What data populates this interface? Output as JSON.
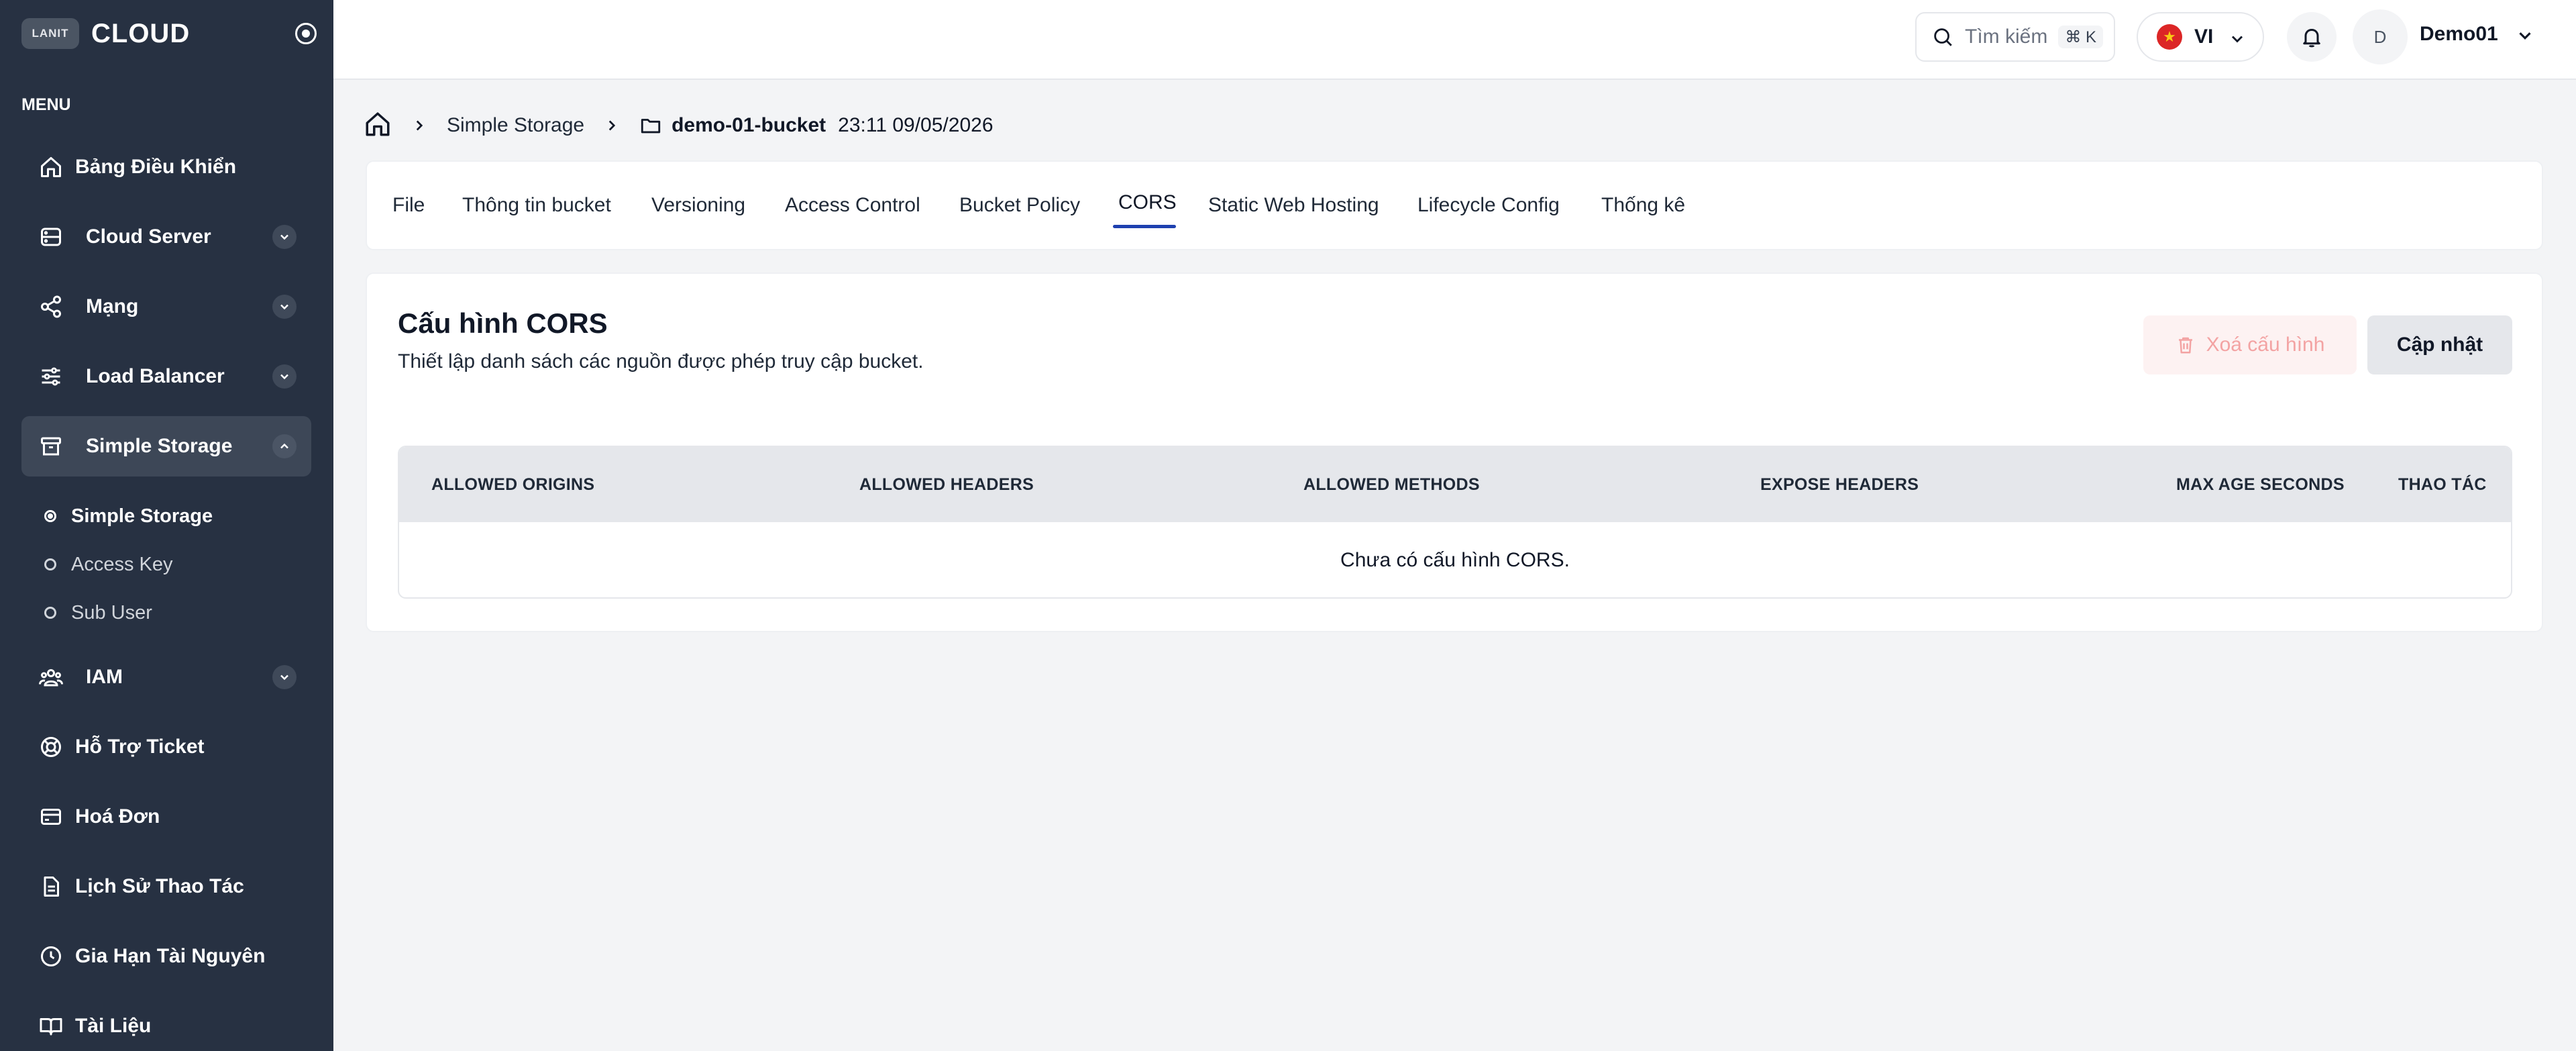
{
  "sidebar": {
    "logo_badge": "LANIT",
    "logo_text": "CLOUD",
    "menu_label": "MENU",
    "items": [
      {
        "label": "Bảng Điều Khiển"
      },
      {
        "label": "Cloud Server"
      },
      {
        "label": "Mạng"
      },
      {
        "label": "Load Balancer"
      },
      {
        "label": "Simple Storage"
      },
      {
        "label": "IAM"
      },
      {
        "label": "Hỗ Trợ Ticket"
      },
      {
        "label": "Hoá Đơn"
      },
      {
        "label": "Lịch Sử Thao Tác"
      },
      {
        "label": "Gia Hạn Tài Nguyên"
      },
      {
        "label": "Tài Liệu"
      }
    ],
    "sub_items": [
      {
        "label": "Simple Storage",
        "active": true
      },
      {
        "label": "Access Key",
        "active": false
      },
      {
        "label": "Sub User",
        "active": false
      }
    ]
  },
  "header": {
    "search_placeholder": "Tìm kiếm",
    "search_shortcut": "⌘ K",
    "language": "VI",
    "avatar_initial": "D",
    "user_name": "Demo01"
  },
  "breadcrumb": {
    "section": "Simple Storage",
    "bucket": "demo-01-bucket",
    "timestamp": "23:11 09/05/2026"
  },
  "tabs": [
    {
      "label": "File"
    },
    {
      "label": "Thông tin bucket"
    },
    {
      "label": "Versioning"
    },
    {
      "label": "Access Control"
    },
    {
      "label": "Bucket Policy"
    },
    {
      "label": "CORS",
      "active": true
    },
    {
      "label": "Static Web Hosting"
    },
    {
      "label": "Lifecycle Config"
    },
    {
      "label": "Thống kê"
    }
  ],
  "cors": {
    "title": "Cấu hình CORS",
    "subtitle": "Thiết lập danh sách các nguồn được phép truy cập bucket.",
    "delete_label": "Xoá cấu hình",
    "update_label": "Cập nhật",
    "columns": [
      "ALLOWED ORIGINS",
      "ALLOWED HEADERS",
      "ALLOWED METHODS",
      "EXPOSE HEADERS",
      "MAX AGE SECONDS",
      "THAO TÁC"
    ],
    "empty_message": "Chưa có cấu hình CORS."
  },
  "colors": {
    "sidebar_bg": "#273142",
    "accent": "#1e40af",
    "danger_light": "#f3a3a3"
  }
}
